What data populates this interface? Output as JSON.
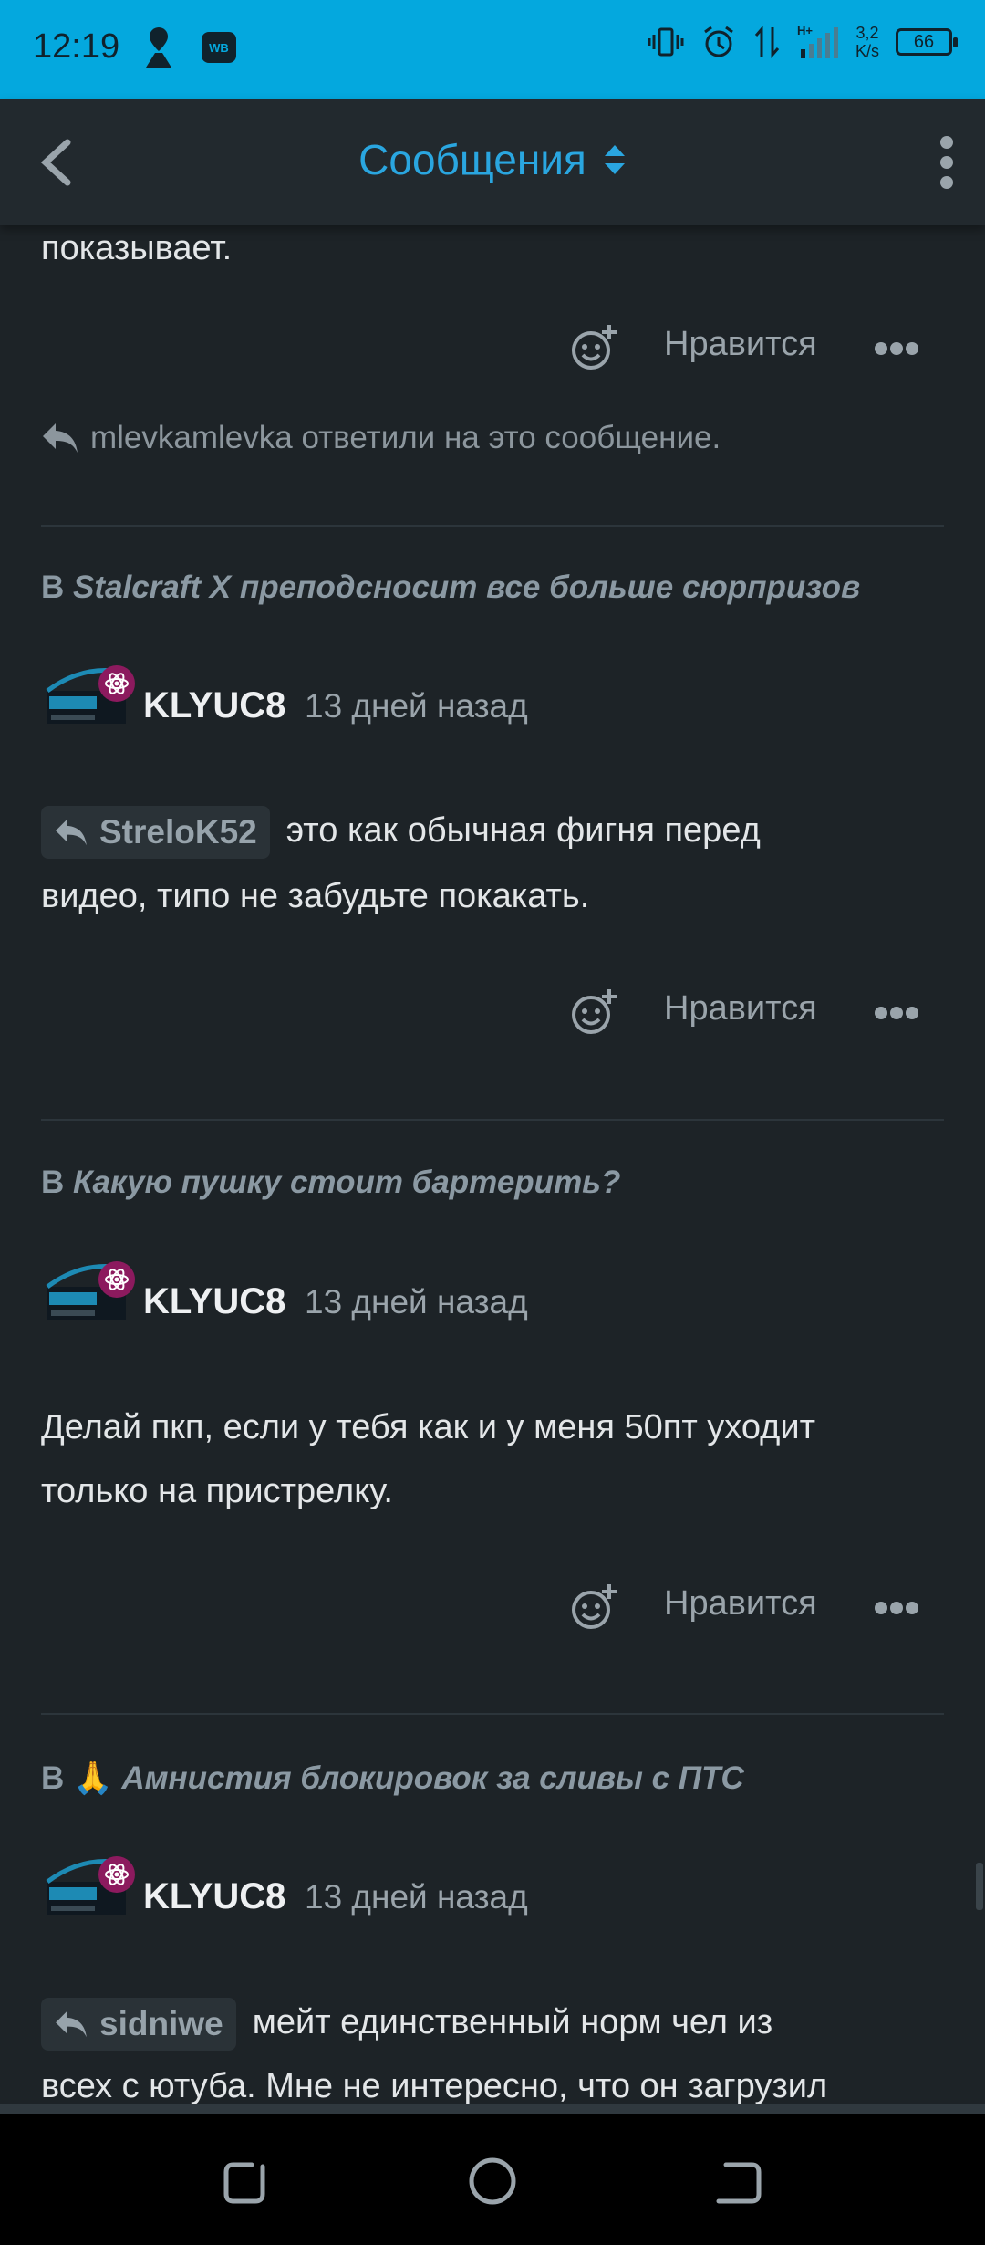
{
  "status": {
    "time": "12:19",
    "speed_top": "3,2",
    "speed_bottom": "K/s",
    "battery": "66",
    "network": "H+"
  },
  "appbar": {
    "title": "Сообщения"
  },
  "top_fragment": {
    "text": "показывает.",
    "like_label": "Нравится",
    "reply_note": "mlevkamlevka ответили на это сообщение."
  },
  "posts": [
    {
      "thread_prefix": "В",
      "thread_title": "Stalcraft X преподсносит все больше сюрпризов",
      "username": "KLYUC8",
      "time": "13 дней назад",
      "quote_user": "StreloK52",
      "line1": "это как обычная фигня перед",
      "line2": "видео, типо не забудьте покакать.",
      "like_label": "Нравится"
    },
    {
      "thread_prefix": "В",
      "thread_title": "Какую пушку стоит бартерить?",
      "username": "KLYUC8",
      "time": "13 дней назад",
      "line1": "Делай пкп, если у тебя как и у меня 50пт уходит",
      "line2": "только на пристрелку.",
      "like_label": "Нравится"
    },
    {
      "thread_prefix": "В",
      "thread_emoji": "🙏",
      "thread_title": "Амнистия блокировок за сливы с ПТС",
      "username": "KLYUC8",
      "time": "13 дней назад",
      "quote_user": "sidniwe",
      "line1": "мейт единственный норм чел из",
      "line2": "всех с ютуба. Мне не интересно, что он загрузил"
    }
  ],
  "colors": {
    "status_bar": "#04a8de",
    "accent": "#2aa6e0",
    "background": "#1d2327",
    "avatar_badge": "#8c1a5e"
  }
}
